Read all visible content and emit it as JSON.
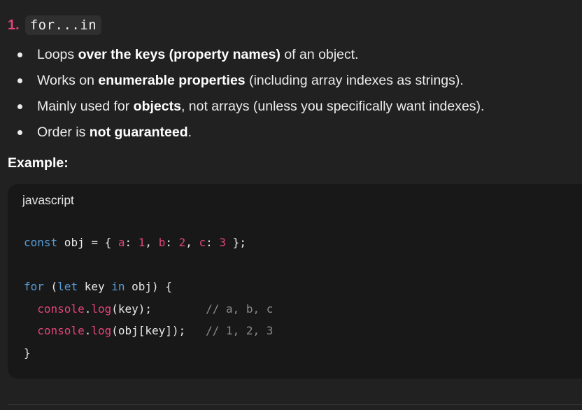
{
  "section": {
    "number": "1.",
    "title_code": "for...in"
  },
  "bullets": [
    {
      "pre": "Loops ",
      "bold": "over the keys (property names)",
      "post": " of an object."
    },
    {
      "pre": "Works on ",
      "bold": "enumerable properties",
      "post": " (including array indexes as strings)."
    },
    {
      "pre": "Mainly used for ",
      "bold": "objects",
      "post": ", not arrays (unless you specifically want indexes)."
    },
    {
      "pre": "Order is ",
      "bold": "not guaranteed",
      "post": "."
    }
  ],
  "example_label": "Example:",
  "code_block": {
    "language": "javascript",
    "lines": [
      "const obj = { a: 1, b: 2, c: 3 };",
      "",
      "for (let key in obj) {",
      "  console.log(key);        // a, b, c",
      "  console.log(obj[key]);   // 1, 2, 3",
      "}"
    ]
  },
  "colors": {
    "background": "#212121",
    "code_background": "#181818",
    "keyword": "#569cd6",
    "property": "#e0457b",
    "comment": "#8a8a8a"
  }
}
